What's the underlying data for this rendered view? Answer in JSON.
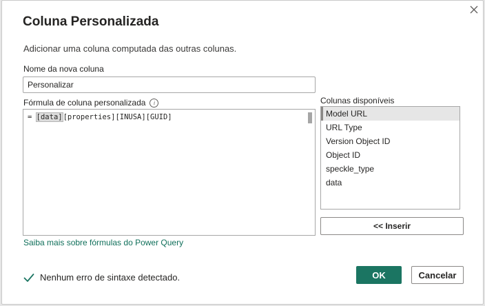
{
  "dialog": {
    "title": "Coluna Personalizada",
    "subtitle": "Adicionar uma coluna computada das outras colunas.",
    "close_icon": "close-icon"
  },
  "new_column": {
    "label": "Nome da nova coluna",
    "value": "Personalizar"
  },
  "formula": {
    "label": "Fórmula de coluna personalizada",
    "info_icon": "info-icon",
    "prefix": "= ",
    "highlight": "[data]",
    "rest": "[properties][INUSA][GUID]"
  },
  "available_columns": {
    "label": "Colunas disponíveis",
    "items": [
      "Model URL",
      "URL Type",
      "Version Object ID",
      "Object ID",
      "speckle_type",
      "data"
    ],
    "selected_index": 0
  },
  "insert_button": "<< Inserir",
  "learn_more_link": "Saiba mais sobre fórmulas do Power Query",
  "status": {
    "icon": "checkmark-icon",
    "text": "Nenhum erro de sintaxe detectado."
  },
  "buttons": {
    "ok": "OK",
    "cancel": "Cancelar"
  },
  "colors": {
    "accent": "#1b7562",
    "link": "#0f6f5a",
    "success": "#1b7562"
  }
}
